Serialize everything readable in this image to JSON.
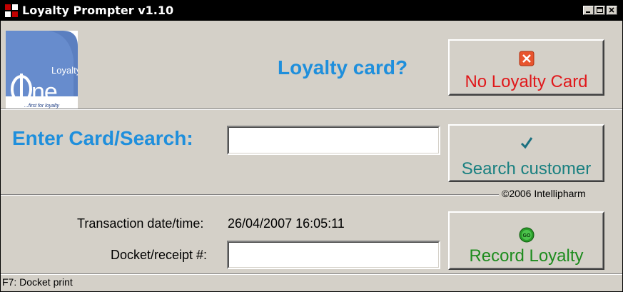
{
  "window": {
    "title": "Loyalty Prompter v1.10"
  },
  "logo": {
    "brand_text": "Loyalty",
    "one_text": "One",
    "tagline": "...first for loyalty"
  },
  "prompt": {
    "question": "Loyalty card?"
  },
  "buttons": {
    "no_card": {
      "label": "No Loyalty Card",
      "icon": "close-x-icon",
      "color": "#e0181b"
    },
    "search": {
      "label": "Search customer",
      "icon": "checkmark-icon",
      "color": "#1a8080"
    },
    "record": {
      "label": "Record Loyalty",
      "icon": "go-icon",
      "color": "#1e8c1e"
    }
  },
  "search": {
    "label": "Enter Card/Search:",
    "value": ""
  },
  "copyright": "©2006 Intellipharm",
  "transaction": {
    "label": "Transaction date/time:",
    "value": "26/04/2007 16:05:11"
  },
  "docket": {
    "label": "Docket/receipt #:",
    "value": ""
  },
  "status_bar": "F7: Docket print",
  "colors": {
    "accent_blue": "#1f8fdc",
    "background": "#d4d0c8"
  }
}
